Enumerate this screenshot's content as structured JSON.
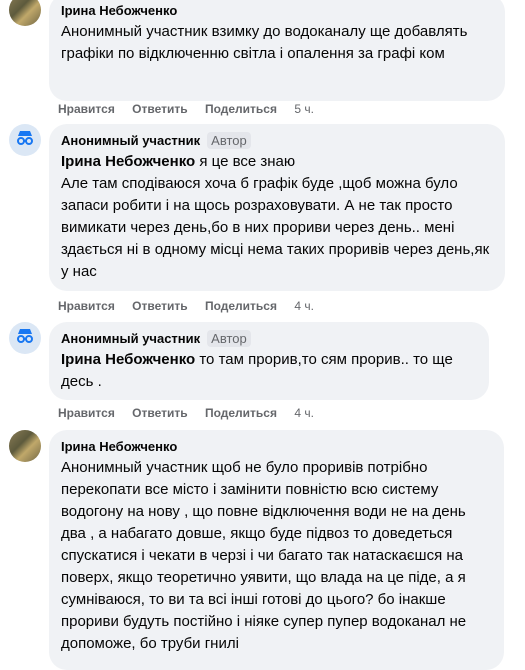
{
  "comments": [
    {
      "author": "Ірина Небожченко",
      "badge": "",
      "mention": "",
      "text": "Анонимный участник взимку до водоканалу ще добавлять графіки по відключенню світла і опалення за графі ком",
      "actions": {
        "like": "Нравится",
        "reply": "Ответить",
        "share": "Поделиться",
        "time": "5 ч."
      }
    },
    {
      "author": "Анонимный участник",
      "badge": "Автор",
      "mention": "Ірина Небожченко",
      "text": "я це все знаю\nАле там сподіваюся хоча б графік буде ,щоб можна було запаси робити і на щось розраховувати. А не так просто вимикати через день,бо в них прориви через день.. мені здається ні в одному місці нема таких проривів через день,як у нас",
      "actions": {
        "like": "Нравится",
        "reply": "Ответить",
        "share": "Поделиться",
        "time": "4 ч."
      }
    },
    {
      "author": "Анонимный участник",
      "badge": "Автор",
      "mention": "Ірина Небожченко",
      "text": "то там прорив,то сям прорив.. то ще десь .",
      "actions": {
        "like": "Нравится",
        "reply": "Ответить",
        "share": "Поделиться",
        "time": "4 ч."
      }
    },
    {
      "author": "Ірина Небожченко",
      "badge": "",
      "mention": "",
      "text": "Анонимный участник щоб не було проривів потрібно перекопати все місто і замінити повністю всю систему водогону на нову , що повне відключення води не на день два , а набагато довше, якщо буде підвоз то доведеться спускатися і чекати в черзі і чи багато так натаскаєшся на поверх, якщо теоретично уявити, що влада на це піде, а я сумніваюся, то ви та всі інші готові до цього? бо інакше прориви будуть постійно і ніяке супер пупер водоканал не допоможе, бо труби гнилі",
      "actions": {
        "like": "",
        "reply": "",
        "share": "",
        "time": ""
      }
    }
  ],
  "colors": {
    "bubble": "#f0f2f5",
    "meta": "#65676b",
    "text": "#050505",
    "anon_avatar": "#dbe7f5"
  }
}
